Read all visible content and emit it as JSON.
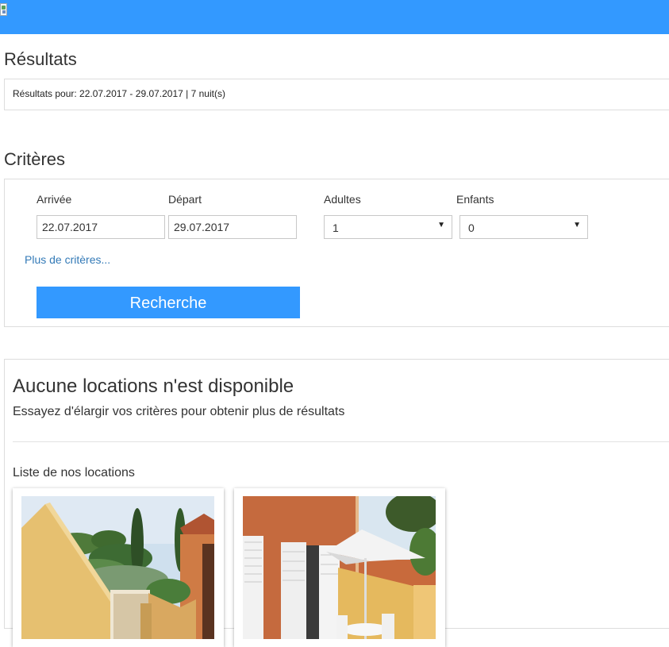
{
  "results": {
    "title": "Résultats",
    "summary": "Résultats pour: 22.07.2017 - 29.07.2017 | 7 nuit(s)"
  },
  "criteria": {
    "title": "Critères",
    "arrival_label": "Arrivée",
    "arrival_value": "22.07.2017",
    "departure_label": "Départ",
    "departure_value": "29.07.2017",
    "adults_label": "Adultes",
    "adults_value": "1",
    "children_label": "Enfants",
    "children_value": "0",
    "more_link": "Plus de critères...",
    "search_button": "Recherche"
  },
  "availability": {
    "title": "Aucune locations n'est disponible",
    "subtitle": "Essayez d'élargir vos critères pour obtenir plus de résultats",
    "list_title": "Liste de nos locations"
  },
  "icons": {
    "select_arrow": "▼",
    "broken_image": "broken-image-icon"
  },
  "colors": {
    "brand_blue": "#3399ff",
    "link_blue": "#337ab7"
  }
}
